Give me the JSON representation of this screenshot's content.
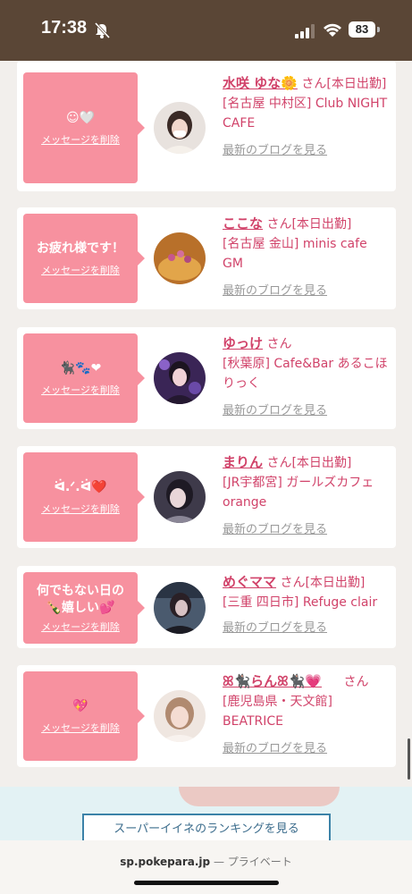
{
  "status_bar": {
    "time": "17:38",
    "battery": "83"
  },
  "cards": [
    {
      "message": "☺🤍",
      "delete_label": "メッセージを削除",
      "name": "水咲 ゆな🌼",
      "san": "さん",
      "status": "[本日出勤]",
      "shop": "[名古屋 中村区] Club NIGHT CAFE",
      "blog_label": "最新のブログを見る"
    },
    {
      "message": "お疲れ様です！",
      "delete_label": "メッセージを削除",
      "name": "ここな",
      "san": "さん",
      "status": "[本日出勤]",
      "shop": "[名古屋 金山] minis cafe GM",
      "blog_label": "最新のブログを見る"
    },
    {
      "message": "🐈‍⬛🐾❤",
      "delete_label": "メッセージを削除",
      "name": "ゆっけ",
      "san": "さん",
      "status": "",
      "shop": "[秋葉原] Cafe&Bar あるこほりっく",
      "blog_label": "最新のブログを見る"
    },
    {
      "message": "ᐛ.ᐟ.ᐛ❤️",
      "delete_label": "メッセージを削除",
      "name": "まりん",
      "san": "さん",
      "status": "[本日出勤]",
      "shop": "[JR宇都宮] ガールズカフェ orange",
      "blog_label": "最新のブログを見る"
    },
    {
      "message": "何でもない日の🍾嬉しい💕",
      "delete_label": "メッセージを削除",
      "name": "めぐママ",
      "san": "さん",
      "status": "[本日出勤]",
      "shop": "[三重 四日市] Refuge clair",
      "blog_label": "最新のブログを見る"
    },
    {
      "message": "💖",
      "delete_label": "メッセージを削除",
      "name": "ꕤ🐈‍⬛らんꕤ🐈‍⬛💗",
      "san": "さん",
      "status": "",
      "shop": "[鹿児島県・天文館] BEATRICE",
      "blog_label": "最新のブログを見る"
    }
  ],
  "ranking_button": "スーパーイイネのランキングを見る",
  "url_bar": {
    "host": "sp.pokepara.jp",
    "separator": "—",
    "mode": "プライベート"
  },
  "colors": {
    "accent": "#d1436a",
    "bubble": "#f7919f",
    "status_bar": "#5a4636"
  }
}
